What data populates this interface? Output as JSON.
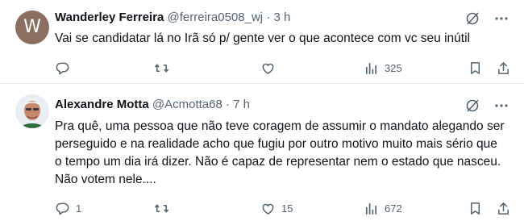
{
  "tweets": [
    {
      "avatar_letter": "W",
      "name": "Wanderley Ferreira",
      "handle": "@ferreira0508_wj",
      "separator": "·",
      "time": "3 h",
      "text": "Vai se candidatar lá no Irã só p/  gente ver o que acontece com vc seu inútil",
      "replies": "",
      "retweets": "",
      "likes": "",
      "views": "325"
    },
    {
      "name": "Alexandre Motta",
      "handle": "@Acmotta68",
      "separator": "·",
      "time": "7 h",
      "text": "Pra quê, uma pessoa que não teve coragem de assumir o mandato alegando ser perseguido e na realidade acho que fugiu por outro motivo muito mais sério que o tempo um dia irá dizer.  Não é capaz de representar nem o estado que nasceu. Não votem nele....",
      "replies": "1",
      "retweets": "",
      "likes": "15",
      "views": "672"
    }
  ],
  "icons": {
    "grok": "grok-icon",
    "more": "more-icon",
    "reply": "reply-icon",
    "retweet": "retweet-icon",
    "like": "heart-icon",
    "views": "views-icon",
    "bookmark": "bookmark-icon",
    "share": "share-icon"
  },
  "colors": {
    "text": "#0f1419",
    "secondary": "#536471",
    "divider": "#e6ecf0"
  }
}
